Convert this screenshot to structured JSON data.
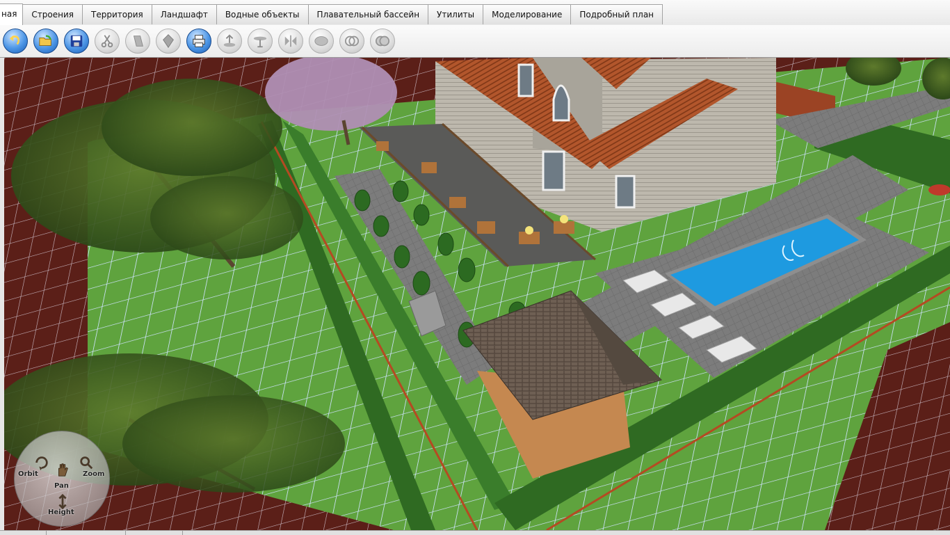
{
  "tabs": [
    {
      "label": "ная",
      "active": true
    },
    {
      "label": "Строения"
    },
    {
      "label": "Территория"
    },
    {
      "label": "Ландшафт"
    },
    {
      "label": "Водные объекты"
    },
    {
      "label": "Плавательный бассейн"
    },
    {
      "label": "Утилиты"
    },
    {
      "label": "Моделирование"
    },
    {
      "label": "Подробный план"
    }
  ],
  "toolbar": [
    {
      "icon": "undo-icon",
      "enabled": true
    },
    {
      "icon": "open-folder-icon",
      "enabled": true
    },
    {
      "icon": "save-disk-icon",
      "enabled": true
    },
    {
      "icon": "scissors-icon",
      "enabled": false
    },
    {
      "icon": "copy-icon",
      "enabled": false
    },
    {
      "icon": "paste-icon",
      "enabled": false
    },
    {
      "icon": "print-icon",
      "enabled": true
    },
    {
      "icon": "raise-icon",
      "enabled": false
    },
    {
      "icon": "table-icon",
      "enabled": false
    },
    {
      "icon": "mirror-icon",
      "enabled": false
    },
    {
      "icon": "ellipse-icon",
      "enabled": false
    },
    {
      "icon": "intersect-icon",
      "enabled": false
    },
    {
      "icon": "union-icon",
      "enabled": false
    }
  ],
  "navigation": {
    "orbit": "Orbit",
    "pan": "Pan",
    "zoom": "Zoom",
    "height": "Height"
  },
  "colors": {
    "grass": "#5fa33e",
    "grid_line": "#cfe3ff",
    "soil": "#5b1f18",
    "hedge": "#2f6a22",
    "pool_water": "#1e9ae0",
    "paving": "#7c7c7c",
    "roof": "#b2562c",
    "siding": "#b9b5ab",
    "toolbar_active": "#3b82d6"
  }
}
